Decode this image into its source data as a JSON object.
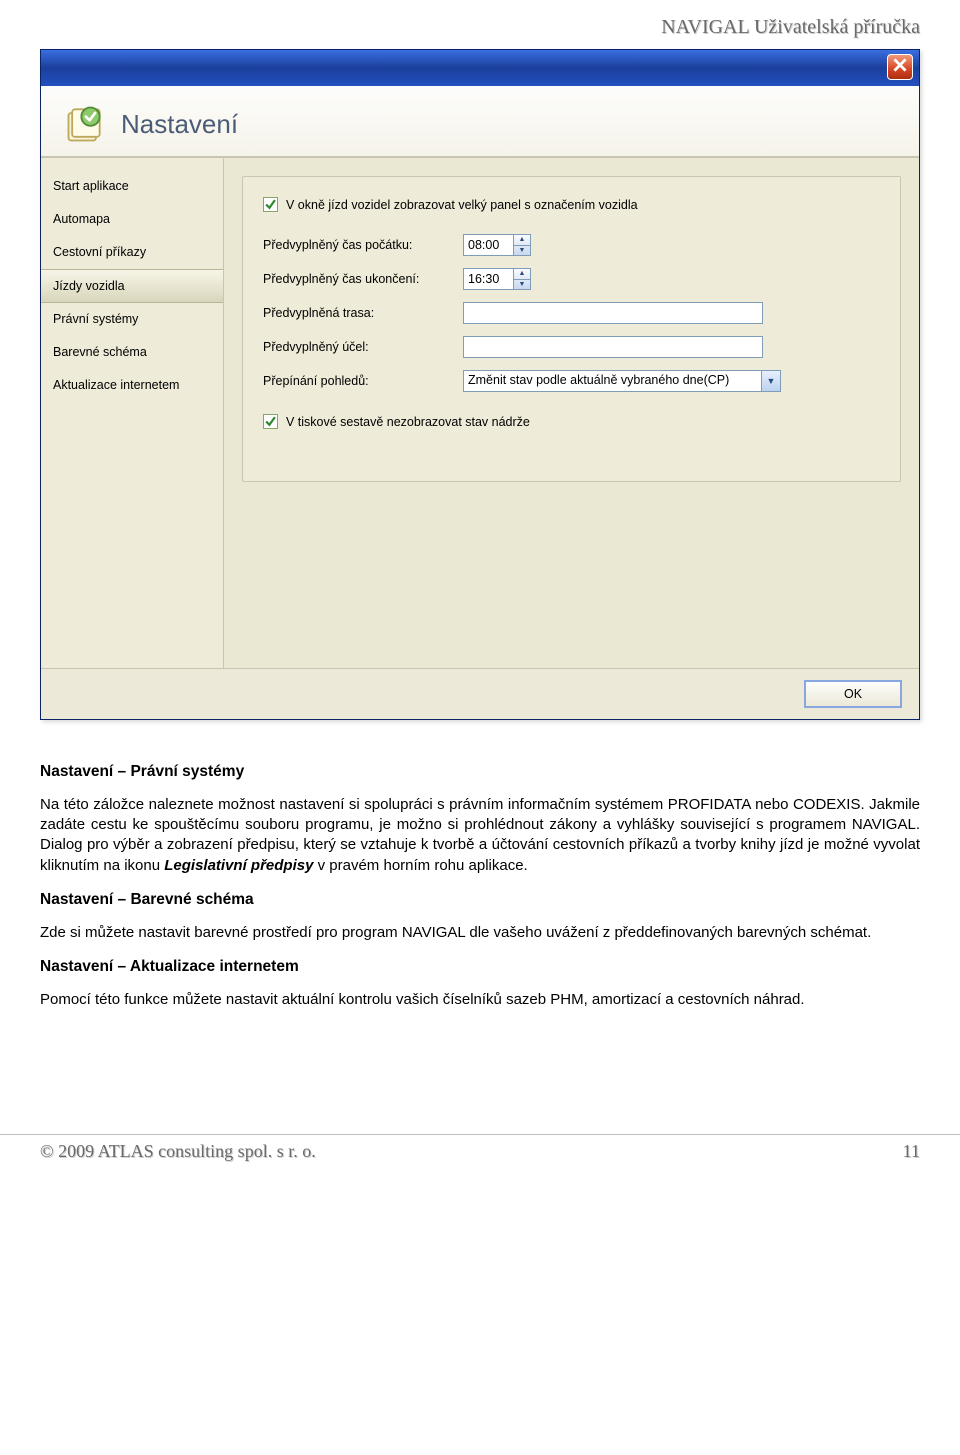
{
  "page": {
    "header_right": "NAVIGAL    Uživatelská příručka",
    "footer_left": "© 2009  ATLAS consulting spol. s r. o.",
    "footer_right": "11"
  },
  "dialog": {
    "title": "Nastavení",
    "sidebar": {
      "items": [
        {
          "label": "Start aplikace",
          "selected": false
        },
        {
          "label": "Automapa",
          "selected": false
        },
        {
          "label": "Cestovní příkazy",
          "selected": false
        },
        {
          "label": "Jízdy vozidla",
          "selected": true
        },
        {
          "label": "Právní systémy",
          "selected": false
        },
        {
          "label": "Barevné schéma",
          "selected": false
        },
        {
          "label": "Aktualizace internetem",
          "selected": false
        }
      ]
    },
    "form": {
      "checkbox1_label": "V okně jízd vozidel zobrazovat velký panel s označením vozidla",
      "checkbox1_checked": true,
      "start_time_label": "Předvyplněný čas počátku:",
      "start_time_value": "08:00",
      "end_time_label": "Předvyplněný čas ukončení:",
      "end_time_value": "16:30",
      "route_label": "Předvyplněná trasa:",
      "route_value": "",
      "purpose_label": "Předvyplněný účel:",
      "purpose_value": "",
      "switch_label": "Přepínání pohledů:",
      "switch_value": "Změnit stav podle aktuálně vybraného dne(CP)",
      "checkbox2_label": "V tiskové sestavě nezobrazovat stav nádrže",
      "checkbox2_checked": true
    },
    "ok_label": "OK"
  },
  "doc": {
    "h1": "Nastavení – Právní systémy",
    "p1a": "Na této záložce naleznete možnost nastavení si spolupráci s právním informačním systémem PROFIDATA nebo CODEXIS. Jakmile zadáte cestu ke spouštěcímu souboru programu, je možno si prohlédnout zákony a vyhlášky související s programem NAVIGAL. Dialog pro výběr a zobrazení předpisu, který se vztahuje k tvorbě a účtování cestovních příkazů a tvorby knihy jízd je možné vyvolat kliknutím na ikonu ",
    "p1_leg": "Legislativní předpisy",
    "p1b": " v pravém horním rohu aplikace.",
    "h2": "Nastavení – Barevné schéma",
    "p2": "Zde si můžete nastavit barevné prostředí pro program NAVIGAL dle vašeho uvážení z předdefinovaných barevných schémat.",
    "h3": "Nastavení – Aktualizace internetem",
    "p3": "Pomocí této funkce můžete nastavit aktuální kontrolu vašich číselníků sazeb PHM, amortizací a cestovních náhrad."
  }
}
